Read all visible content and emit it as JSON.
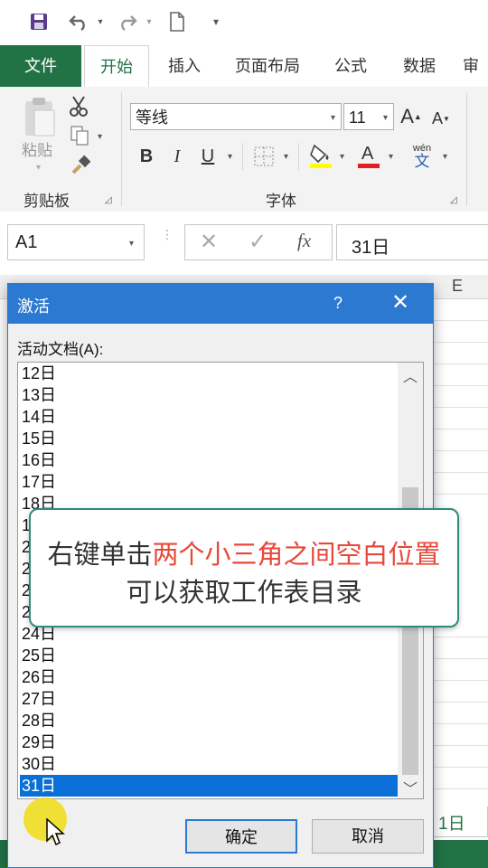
{
  "qat": {
    "icons": [
      "save-icon",
      "undo-icon",
      "redo-icon",
      "new-document-icon",
      "customize-icon"
    ]
  },
  "tabs": [
    {
      "label": "文件"
    },
    {
      "label": "开始"
    },
    {
      "label": "插入"
    },
    {
      "label": "页面布局"
    },
    {
      "label": "公式"
    },
    {
      "label": "数据"
    },
    {
      "label": "审"
    }
  ],
  "ribbon": {
    "clipboard": {
      "paste_label": "粘贴",
      "group_label": "剪贴板"
    },
    "font": {
      "font_name": "等线",
      "font_size": "11",
      "grow": "A",
      "shrink": "A",
      "bold": "B",
      "italic": "I",
      "underline": "U",
      "phonetic_top": "wén",
      "phonetic_bottom": "文",
      "group_label": "字体",
      "fill_color": "#FFFF00",
      "font_color": "#E31E1E"
    }
  },
  "formula_bar": {
    "name_box": "A1",
    "fx": "fx",
    "value": "31日"
  },
  "grid": {
    "col_e": "E",
    "sheet_tab": "1日"
  },
  "dialog": {
    "title": "激活",
    "help": "?",
    "list_label": "活动文档(A):",
    "items": [
      "12日",
      "13日",
      "14日",
      "15日",
      "16日",
      "17日",
      "18日",
      "1",
      "2",
      "2",
      "2",
      "2",
      "24日",
      "25日",
      "26日",
      "27日",
      "28日",
      "29日",
      "30日",
      "31日"
    ],
    "selected": "31日",
    "ok": "确定",
    "cancel": "取消"
  },
  "callout": {
    "line1_a": "右键单击",
    "line1_b": "两个小三角之间空白位置",
    "line2": "可以获取工作表目录",
    "highlight_color": "#E8483A"
  }
}
